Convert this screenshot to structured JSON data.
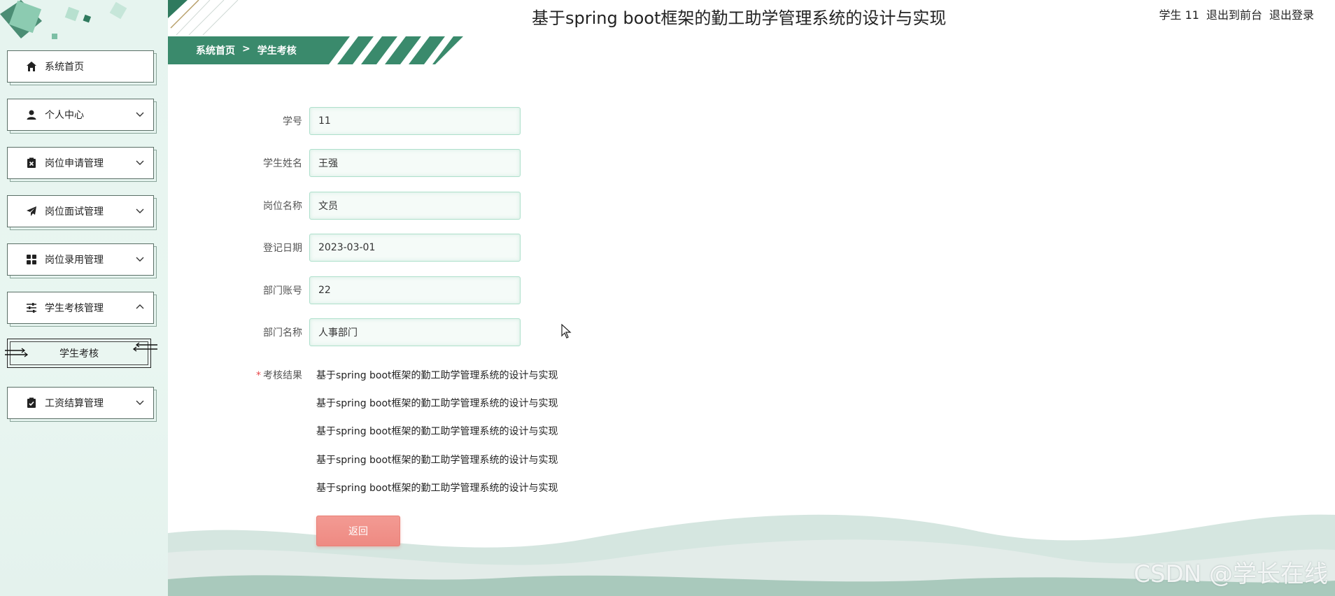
{
  "header": {
    "title": "基于spring boot框架的勤工助学管理系统的设计与实现",
    "user": "学生 11",
    "to_front": "退出到前台",
    "logout": "退出登录"
  },
  "breadcrumb": {
    "home": "系统首页",
    "separator": ">",
    "current": "学生考核"
  },
  "sidebar": {
    "items": [
      {
        "label": "系统首页",
        "icon": "home-icon"
      },
      {
        "label": "个人中心",
        "icon": "user-icon"
      },
      {
        "label": "岗位申请管理",
        "icon": "clipboard-x-icon"
      },
      {
        "label": "岗位面试管理",
        "icon": "send-icon"
      },
      {
        "label": "岗位录用管理",
        "icon": "grid-icon"
      },
      {
        "label": "学生考核管理",
        "icon": "sliders-icon"
      },
      {
        "label": "工资结算管理",
        "icon": "clipboard-check-icon"
      }
    ],
    "sub_item": {
      "label": "学生考核"
    }
  },
  "form": {
    "student_no": {
      "label": "学号",
      "value": "11"
    },
    "student_name": {
      "label": "学生姓名",
      "value": "王强"
    },
    "position_name": {
      "label": "岗位名称",
      "value": "文员"
    },
    "register_date": {
      "label": "登记日期",
      "value": "2023-03-01"
    },
    "dept_account": {
      "label": "部门账号",
      "value": "22"
    },
    "dept_name": {
      "label": "部门名称",
      "value": "人事部门"
    },
    "result": {
      "label": "考核结果",
      "required_mark": "*",
      "lines": [
        "基于spring boot框架的勤工助学管理系统的设计与实现",
        "基于spring boot框架的勤工助学管理系统的设计与实现",
        "基于spring boot框架的勤工助学管理系统的设计与实现",
        "基于spring boot框架的勤工助学管理系统的设计与实现",
        "基于spring boot框架的勤工助学管理系统的设计与实现"
      ]
    },
    "back_label": "返回"
  },
  "watermark": "CSDN @学长在线",
  "colors": {
    "accent": "#3a8a6c",
    "sidebar_bg": "#e6f4ef",
    "input_border": "#aee0cc",
    "button": "#ee8a82",
    "required": "#e9484b"
  }
}
